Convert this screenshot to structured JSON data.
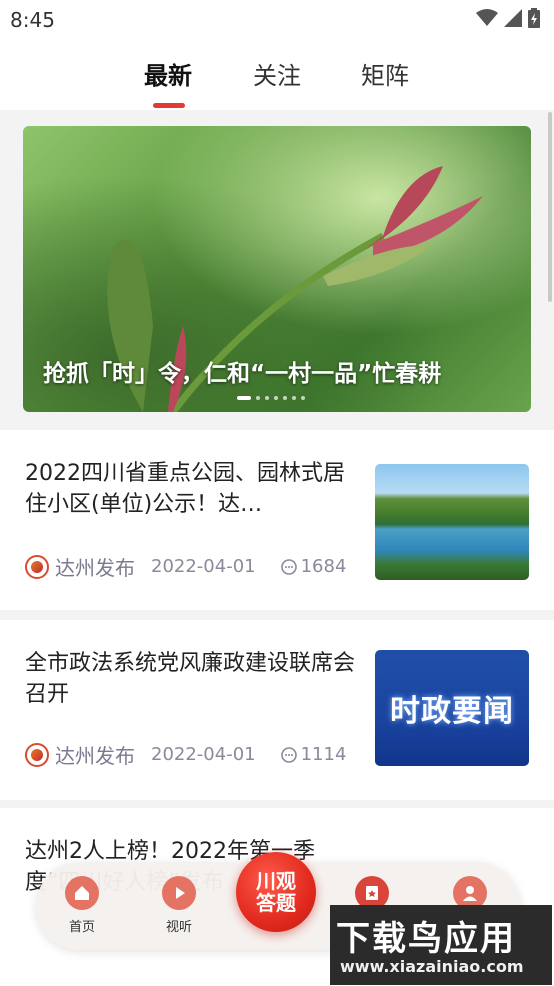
{
  "status": {
    "time": "8:45",
    "icons": [
      "wifi-icon",
      "signal-icon",
      "battery-icon"
    ]
  },
  "tabs": [
    {
      "label": "最新",
      "active": true
    },
    {
      "label": "关注",
      "active": false
    },
    {
      "label": "矩阵",
      "active": false
    }
  ],
  "banner": {
    "caption": "抢抓「时」令，仁和“一村一品”忙春耕",
    "slide_count": 7,
    "active_index": 0
  },
  "news": [
    {
      "title": "2022四川省重点公园、园林式居住小区(单位)公示！达…",
      "source": "达州发布",
      "date": "2022-04-01",
      "comments": "1684",
      "thumb": "lake-landscape"
    },
    {
      "title": "全市政法系统党风廉政建设联席会召开",
      "source": "达州发布",
      "date": "2022-04-01",
      "comments": "1114",
      "thumb_text": "时政要闻"
    },
    {
      "title": "达州2人上榜！2022年第一季度“四川好人榜”发布"
    }
  ],
  "bottom_nav": {
    "home": "首页",
    "video": "视听",
    "center": "川观\n答题"
  },
  "watermark": {
    "big": "下载鸟应用",
    "small": "www.xiazainiao.com"
  },
  "colors": {
    "accent": "#e53935",
    "nav_icon": "#e57363"
  }
}
